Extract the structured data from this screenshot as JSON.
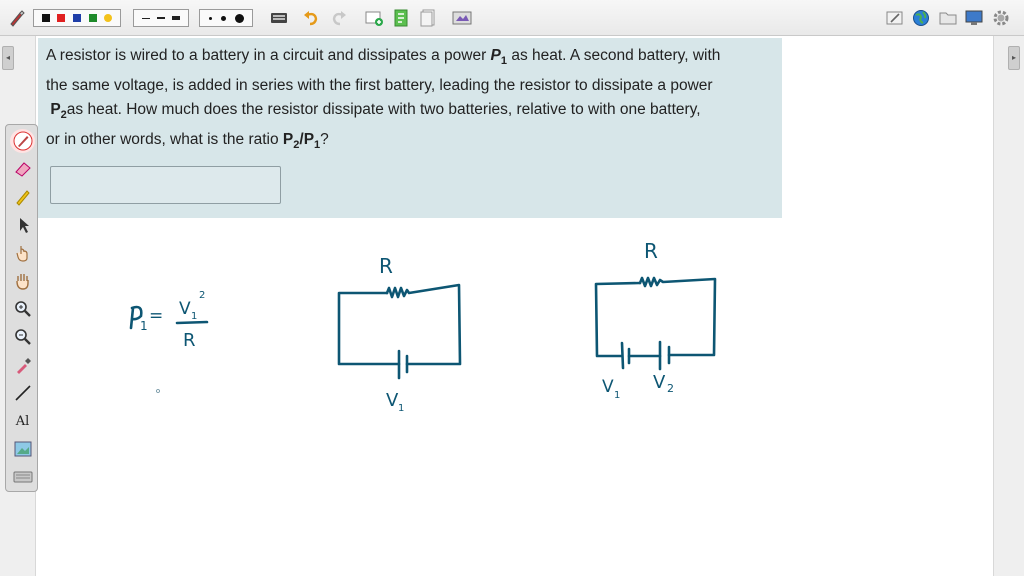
{
  "toolbar": {
    "items": [
      "pen-tool-icon",
      "color-palette",
      "line-style-palette",
      "point-size-palette",
      "keyboard-icon",
      "undo-icon",
      "redo-icon",
      "new-page-icon",
      "page-icon",
      "document-icon",
      "screenshot-icon"
    ],
    "colors": [
      "#111111",
      "#e02020",
      "#1f3ea8",
      "#1e8a2a",
      "#f3c21b"
    ],
    "right_items": [
      "edit-icon",
      "globe-icon",
      "folder-icon",
      "monitor-icon",
      "settings-icon"
    ]
  },
  "question": {
    "line1": "A resistor is wired to a battery in a circuit and dissipates a power ",
    "line1_sym": "P",
    "line1_sub": "1",
    "line1_end": " as heat.  A second battery, with",
    "line2": "the same voltage, is added in series with the first battery, leading the resistor to dissipate a power",
    "line3_sym": "P",
    "line3_sub": "2",
    "line3_end": "as heat. How much does the resistor dissipate with two batteries, relative to with one battery,",
    "line4": "or in other words, what is the ratio ",
    "line4_p2": "P",
    "line4_sub2": "2",
    "line4_slash": "/",
    "line4_p1": "P",
    "line4_sub1": "1",
    "line4_end": "?",
    "answer_value": ""
  },
  "whiteboard": {
    "formula_lhs": "P",
    "formula_lhs_sub": "1",
    "formula_eq": "=",
    "formula_num": "V",
    "formula_num_sub": "1",
    "formula_num_sup": "2",
    "formula_den": "R",
    "circuit1_resistor_label": "R",
    "circuit1_battery_label": "V",
    "circuit1_battery_sub": "1",
    "circuit2_resistor_label": "R",
    "circuit2_battery1_label": "V",
    "circuit2_battery1_sub": "1",
    "circuit2_battery2_label": "V",
    "circuit2_battery2_sub": "2",
    "ink_color": "#0d5673"
  },
  "tools": [
    "pen-icon",
    "eraser-icon",
    "highlighter-icon",
    "select-arrow-icon",
    "pointer-hand-icon",
    "pan-hand-icon",
    "zoom-in-icon",
    "zoom-out-icon",
    "eyedropper-icon",
    "line-icon",
    "text-tool-icon",
    "image-tool-icon",
    "keyboard-tool-icon"
  ],
  "text_tool_label": "Al"
}
